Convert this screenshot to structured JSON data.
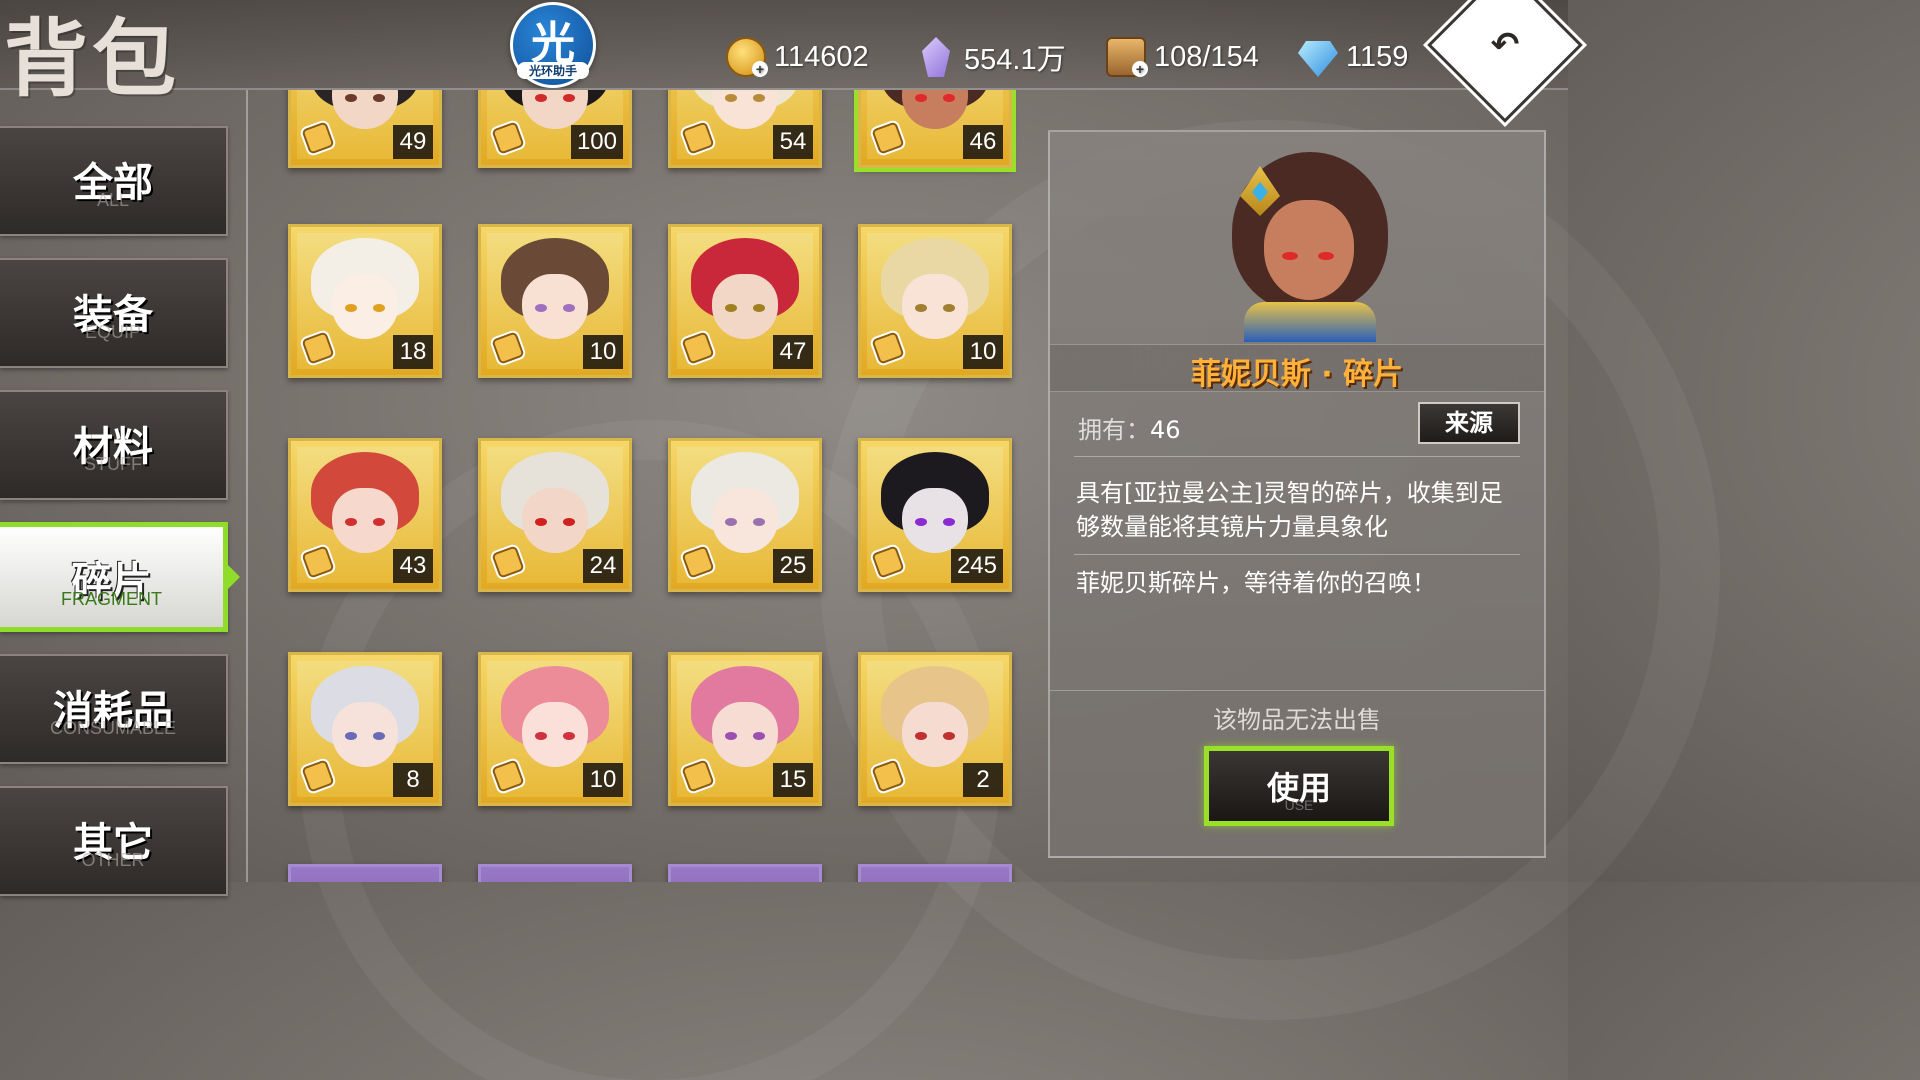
{
  "header": {
    "title": "背包",
    "helper_badge": {
      "glyph": "光",
      "label": "光环助手"
    },
    "resources": [
      {
        "icon": "gold-coin-icon",
        "value": "114602"
      },
      {
        "icon": "purple-crystal-icon",
        "value": "554.1万"
      },
      {
        "icon": "treasure-chest-icon",
        "value": "108/154"
      },
      {
        "icon": "blue-diamond-icon",
        "value": "1159"
      }
    ],
    "back_icon": "return-arrow-icon"
  },
  "sidebar": {
    "tabs": [
      {
        "zh": "全部",
        "en": "ALL"
      },
      {
        "zh": "装备",
        "en": "EQUIP"
      },
      {
        "zh": "材料",
        "en": "STUFF"
      },
      {
        "zh": "碎片",
        "en": "FRAGMENT",
        "active": true
      },
      {
        "zh": "消耗品",
        "en": "CONSUMABLE"
      },
      {
        "zh": "其它",
        "en": "OTHER"
      }
    ]
  },
  "grid": {
    "items": [
      {
        "count": "49",
        "hair": "#2a2424",
        "eyes": "#6a3a2a",
        "face": "#f3d7c6"
      },
      {
        "count": "100",
        "hair": "#1e1a1a",
        "eyes": "#d02a2a",
        "face": "#f3d7c6"
      },
      {
        "count": "54",
        "hair": "#efe6d2",
        "eyes": "#b88a3a",
        "face": "#f8e3d6"
      },
      {
        "count": "46",
        "hair": "#4a2a22",
        "eyes": "#e02a2a",
        "face": "#c77e5e",
        "selected": true
      },
      {
        "count": "18",
        "hair": "#f3efe6",
        "eyes": "#e0a020",
        "face": "#fbeee4"
      },
      {
        "count": "10",
        "hair": "#6a4a36",
        "eyes": "#a070c0",
        "face": "#f8e0d2"
      },
      {
        "count": "47",
        "hair": "#c8283a",
        "eyes": "#a08020",
        "face": "#f3d7c6"
      },
      {
        "count": "10",
        "hair": "#ead8a4",
        "eyes": "#a08030",
        "face": "#f8e3d6"
      },
      {
        "count": "43",
        "hair": "#d2483a",
        "eyes": "#d03030",
        "face": "#f6d9cc"
      },
      {
        "count": "24",
        "hair": "#e6e2da",
        "eyes": "#d02020",
        "face": "#f2d6c8"
      },
      {
        "count": "25",
        "hair": "#ece8e2",
        "eyes": "#9a70b0",
        "face": "#f8e6dc"
      },
      {
        "count": "245",
        "hair": "#1c1a1e",
        "eyes": "#8a2ad0",
        "face": "#e8e2e6"
      },
      {
        "count": "8",
        "hair": "#dcdce4",
        "eyes": "#6a6ab8",
        "face": "#f6e2da"
      },
      {
        "count": "10",
        "hair": "#ec8c98",
        "eyes": "#d03040",
        "face": "#fae0d8"
      },
      {
        "count": "15",
        "hair": "#e27aa0",
        "eyes": "#9a50b0",
        "face": "#f6dcd2"
      },
      {
        "count": "2",
        "hair": "#e6c48a",
        "eyes": "#c03030",
        "face": "#f6dcd0"
      }
    ]
  },
  "detail": {
    "name": "菲妮贝斯 · 碎片",
    "own_label": "拥有：",
    "own_value": "46",
    "source_button": "来源",
    "description_1": "具有[亚拉曼公主]灵智的碎片，收集到足够数量能将其镜片力量具象化",
    "description_2": "菲妮贝斯碎片，等待着你的召唤！",
    "no_sell": "该物品无法出售",
    "use_button_zh": "使用",
    "use_button_en": "USE"
  }
}
